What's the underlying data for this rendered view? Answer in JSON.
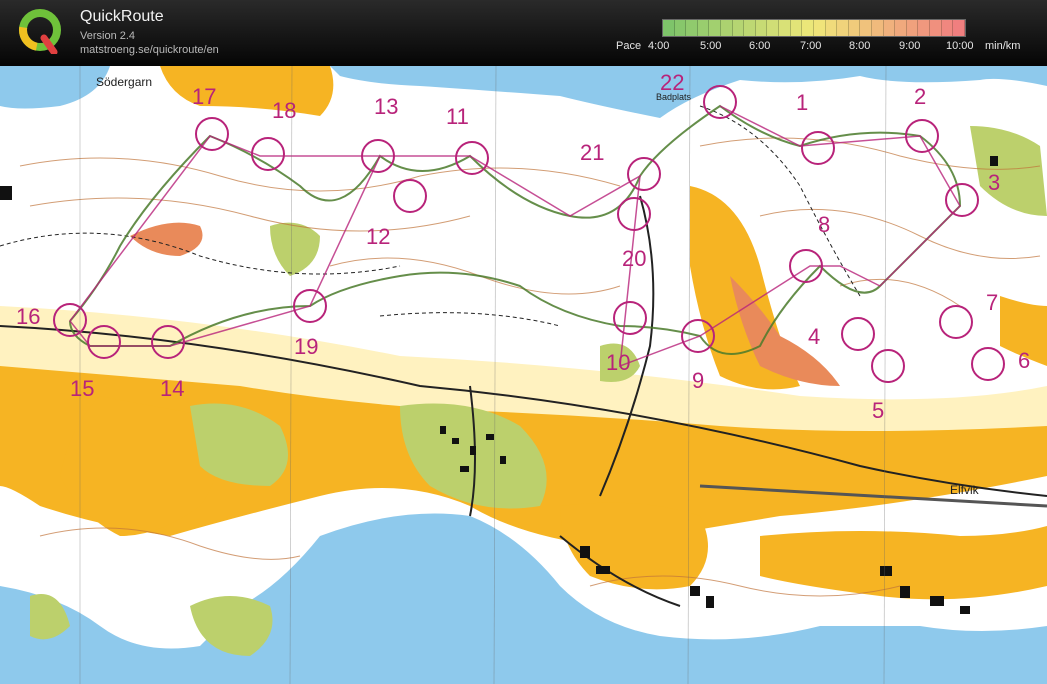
{
  "app": {
    "title": "QuickRoute",
    "version": "Version 2.4",
    "url": "matstroeng.se/quickroute/en"
  },
  "pace_legend": {
    "label": "Pace",
    "unit": "min/km",
    "ticks": [
      "4:00",
      "5:00",
      "6:00",
      "7:00",
      "8:00",
      "9:00",
      "10:00"
    ],
    "colors": {
      "fast": "#7ec46a",
      "medium": "#f0e87a",
      "slow": "#f07f7f"
    }
  },
  "map": {
    "colors": {
      "open_land": "#f6b423",
      "semi_open": "#fff2c0",
      "forest": "#ffffff",
      "green": "#bcd06c",
      "water": "#8ec9ec",
      "course": "#b8237a",
      "contour": "#c0743a",
      "route": "#4a7a2a"
    },
    "place_names": [
      "Södergarn",
      "Elfvik",
      "Badplats"
    ],
    "controls": [
      {
        "label": "1"
      },
      {
        "label": "2"
      },
      {
        "label": "3"
      },
      {
        "label": "4"
      },
      {
        "label": "5"
      },
      {
        "label": "6"
      },
      {
        "label": "7"
      },
      {
        "label": "8"
      },
      {
        "label": "9"
      },
      {
        "label": "10"
      },
      {
        "label": "11"
      },
      {
        "label": "12"
      },
      {
        "label": "13"
      },
      {
        "label": "14"
      },
      {
        "label": "15"
      },
      {
        "label": "16"
      },
      {
        "label": "17"
      },
      {
        "label": "18"
      },
      {
        "label": "19"
      },
      {
        "label": "20"
      },
      {
        "label": "21"
      },
      {
        "label": "22"
      }
    ]
  }
}
